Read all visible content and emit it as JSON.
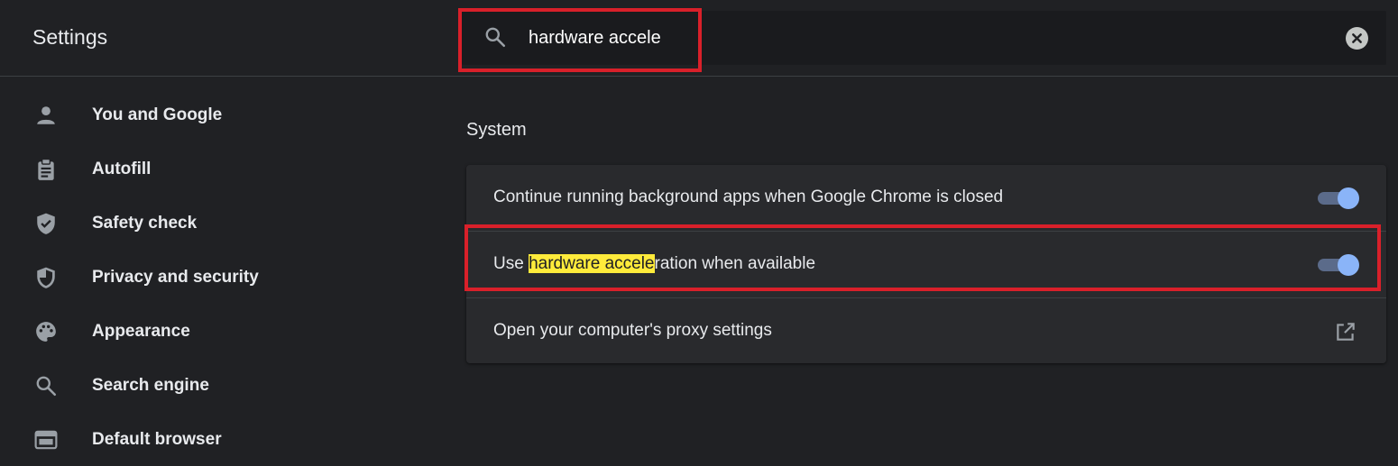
{
  "header": {
    "title": "Settings",
    "search": {
      "value": "hardware accele"
    }
  },
  "sidebar": {
    "items": [
      {
        "label": "You and Google",
        "icon": "person-icon"
      },
      {
        "label": "Autofill",
        "icon": "clipboard-icon"
      },
      {
        "label": "Safety check",
        "icon": "shield-check-icon"
      },
      {
        "label": "Privacy and security",
        "icon": "shield-half-icon"
      },
      {
        "label": "Appearance",
        "icon": "palette-icon"
      },
      {
        "label": "Search engine",
        "icon": "search-icon"
      },
      {
        "label": "Default browser",
        "icon": "browser-window-icon"
      }
    ]
  },
  "main": {
    "section_title": "System",
    "rows": [
      {
        "label": "Continue running background apps when Google Chrome is closed",
        "control": "toggle",
        "enabled": true
      },
      {
        "label_prefix": "Use ",
        "label_match": "hardware accele",
        "label_suffix": "ration when available",
        "control": "toggle",
        "enabled": true
      },
      {
        "label": "Open your computer's proxy settings",
        "control": "external-link-icon"
      }
    ]
  },
  "colors": {
    "background": "#202124",
    "card": "#292a2d",
    "accent": "#8ab4f8",
    "highlight": "#ffeb3b",
    "annotation": "#d9202a"
  }
}
